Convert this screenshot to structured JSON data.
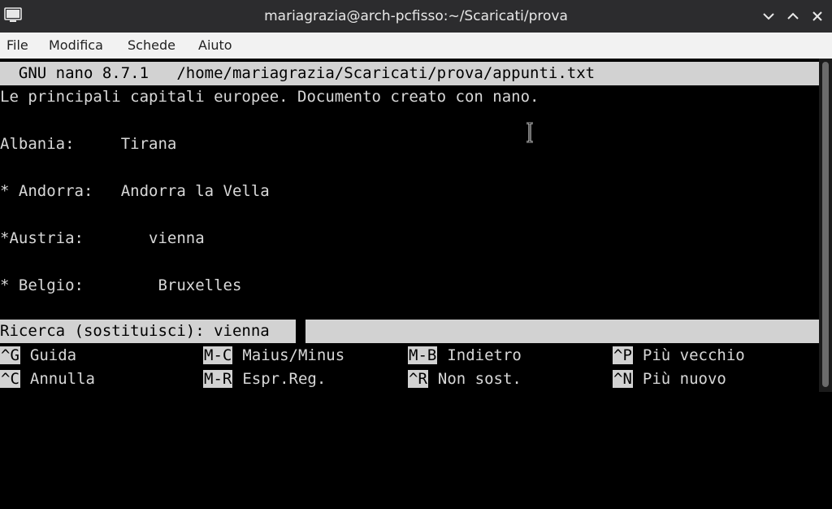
{
  "window": {
    "title": "mariagrazia@arch-pcfisso:~/Scaricati/prova",
    "icons": [
      "terminal-icon",
      "minimize-icon",
      "maximize-icon",
      "close-icon"
    ]
  },
  "menu": {
    "items": [
      "File",
      "Modifica",
      "Schede",
      "Aiuto"
    ]
  },
  "nano": {
    "header": "  GNU nano 8.7.1   /home/mariagrazia/Scaricati/prova/appunti.txt",
    "lines": [
      "Le principali capitali europee. Documento creato con nano.",
      "",
      "Albania:     Tirana",
      "",
      "* Andorra:   Andorra la Vella",
      "",
      "*Austria:       vienna",
      "",
      "* Belgio:        Bruxelles",
      ""
    ],
    "prompt": {
      "label": "Ricerca (sostituisci): ",
      "value": "vienna"
    },
    "shortcuts": [
      {
        "key": "^G",
        "label": "Guida"
      },
      {
        "key": "M-C",
        "label": "Maius/Minus"
      },
      {
        "key": "M-B",
        "label": "Indietro"
      },
      {
        "key": "^P",
        "label": "Più vecchio"
      },
      {
        "key": "^C",
        "label": "Annulla"
      },
      {
        "key": "M-R",
        "label": "Espr.Reg."
      },
      {
        "key": "^R",
        "label": "Non sost."
      },
      {
        "key": "^N",
        "label": "Più nuovo"
      }
    ]
  },
  "colors": {
    "terminal_bg": "#000000",
    "terminal_fg": "#d8d8d8",
    "inverse_bg": "#d2d2d2",
    "titlebar_bg": "#2c2c2e",
    "menubar_bg": "#f2f2f2"
  }
}
